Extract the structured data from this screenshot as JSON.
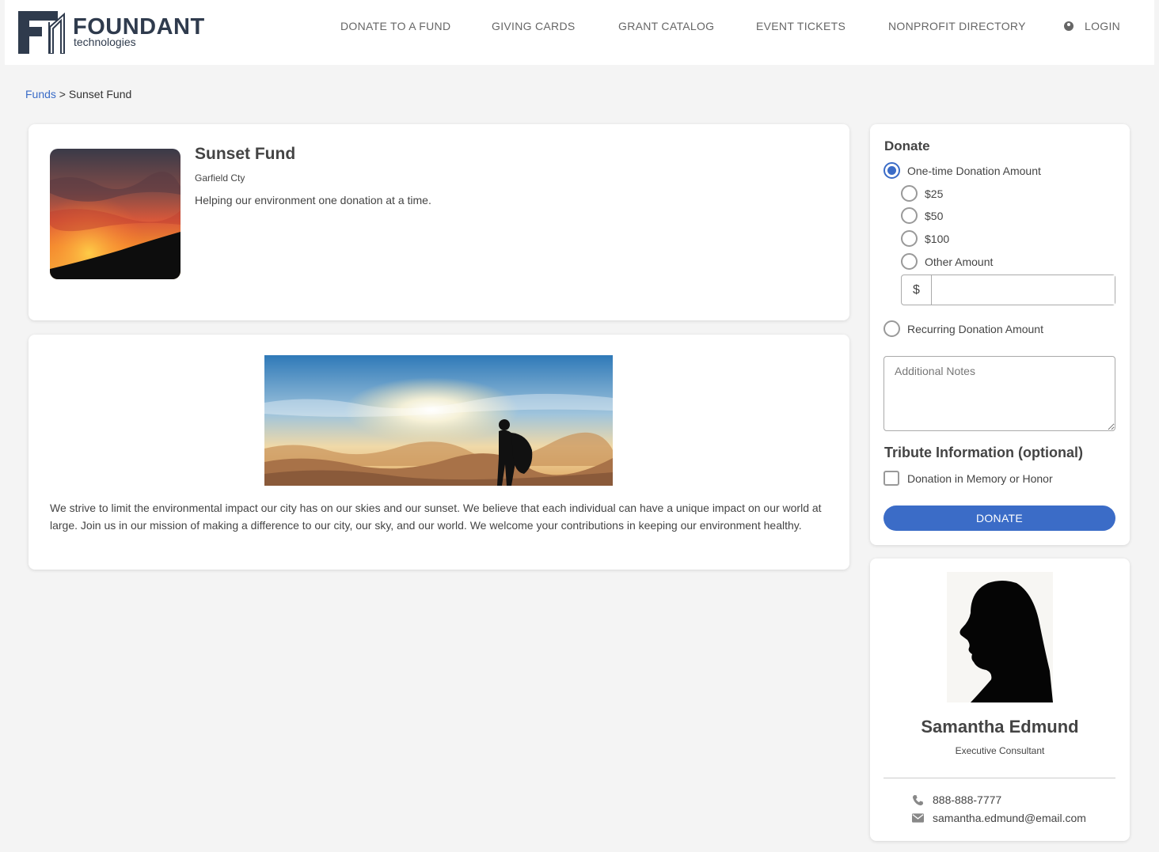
{
  "brand": {
    "name": "FOUNDANT",
    "sub": "technologies"
  },
  "nav": {
    "donate": "DONATE TO A FUND",
    "cards": "GIVING CARDS",
    "grants": "GRANT CATALOG",
    "events": "EVENT TICKETS",
    "directory": "NONPROFIT DIRECTORY",
    "login": "LOGIN"
  },
  "breadcrumb": {
    "root": "Funds",
    "separator": " > ",
    "current": "Sunset Fund"
  },
  "fund": {
    "title": "Sunset Fund",
    "location": "Garfield Cty",
    "tagline": "Helping our environment one donation at a time.",
    "description": "We strive to limit the environmental impact our city has on our skies and our sunset. We believe that each individual can have a unique impact on our world at large. Join us in our mission of making a difference to our city, our sky, and our world. We welcome your contributions in keeping our environment healthy."
  },
  "donate": {
    "heading": "Donate",
    "one_time_label": "One-time Donation Amount",
    "one_time_selected": true,
    "amounts": [
      "$25",
      "$50",
      "$100",
      "Other Amount"
    ],
    "currency_prefix": "$",
    "other_amount_value": "",
    "recurring_label": "Recurring Donation Amount",
    "notes_placeholder": "Additional Notes",
    "tribute_heading": "Tribute Information (optional)",
    "tribute_checkbox": "Donation in Memory or Honor",
    "button": "DONATE"
  },
  "contact": {
    "name": "Samantha Edmund",
    "role": "Executive Consultant",
    "phone": "888-888-7777",
    "email": "samantha.edmund@email.com"
  },
  "colors": {
    "accent": "#3b6cc7",
    "background": "#f4f4f4",
    "brand": "#2f3b4d"
  }
}
